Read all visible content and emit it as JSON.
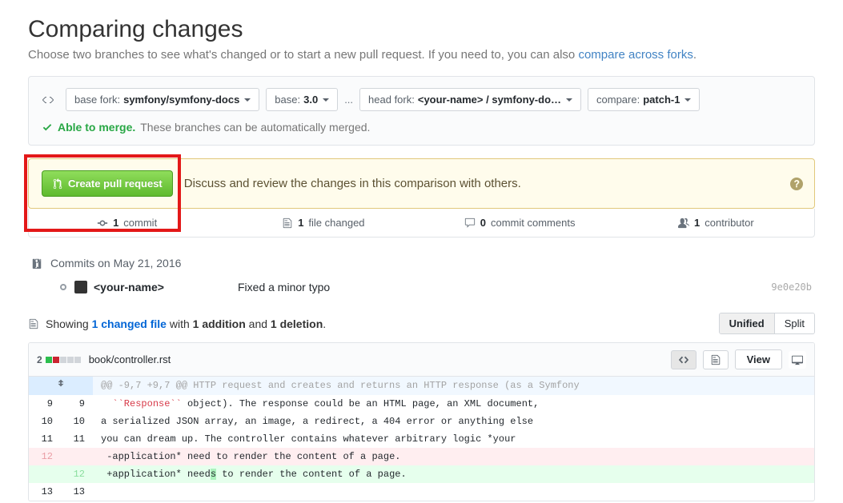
{
  "page": {
    "title": "Comparing changes",
    "subtitle_pre": "Choose two branches to see what's changed or to start a new pull request. If you need to, you can also ",
    "subtitle_link": "compare across forks",
    "subtitle_post": "."
  },
  "branches": {
    "base_fork_label": "base fork:",
    "base_fork_value": "symfony/symfony-docs",
    "base_label": "base:",
    "base_value": "3.0",
    "dots": "...",
    "head_fork_label": "head fork:",
    "head_fork_value": "<your-name> / symfony-do…",
    "compare_label": "compare:",
    "compare_value": "patch-1"
  },
  "merge": {
    "ok_text": "Able to merge.",
    "detail": "These branches can be automatically merged."
  },
  "pr_prompt": {
    "button": "Create pull request",
    "text": "Discuss and review the changes in this comparison with others."
  },
  "stats": {
    "commit_count": "1",
    "commit_label": "commit",
    "file_count": "1",
    "file_label": "file changed",
    "comment_count": "0",
    "comment_label": "commit comments",
    "contrib_count": "1",
    "contrib_label": "contributor"
  },
  "commits": {
    "date_label": "Commits on May 21, 2016",
    "author": "<your-name>",
    "message": "Fixed a minor typo",
    "sha": "9e0e20b"
  },
  "changes": {
    "pre": "Showing ",
    "link": "1 changed file",
    "mid": " with ",
    "add_b": "1 addition",
    "and": " and ",
    "del_b": "1 deletion",
    "post": ".",
    "unified": "Unified",
    "split": "Split"
  },
  "file": {
    "diffstat": "2",
    "path": "book/controller.rst",
    "view": "View"
  },
  "diff": {
    "hunk": "@@ -9,7 +9,7 @@ HTTP request and creates and returns an HTTP response (as a Symfony",
    "l9a": "9",
    "l9b": "9",
    "c9": "``Response`` object). The response could be an HTML page, an XML document,",
    "l10a": "10",
    "l10b": "10",
    "c10": "a serialized JSON array, an image, a redirect, a 404 error or anything else",
    "l11a": "11",
    "l11b": "11",
    "c11": "you can dream up. The controller contains whatever arbitrary logic *your",
    "l12a": "12",
    "c12_del_pre": "application* need",
    "c12_del_post": " to render the content of a page.",
    "l12b": "12",
    "c12_add_pre": "application* need",
    "c12_add_hl": "s",
    "c12_add_post": " to render the content of a page.",
    "l13a": "13",
    "l13b": "13"
  }
}
